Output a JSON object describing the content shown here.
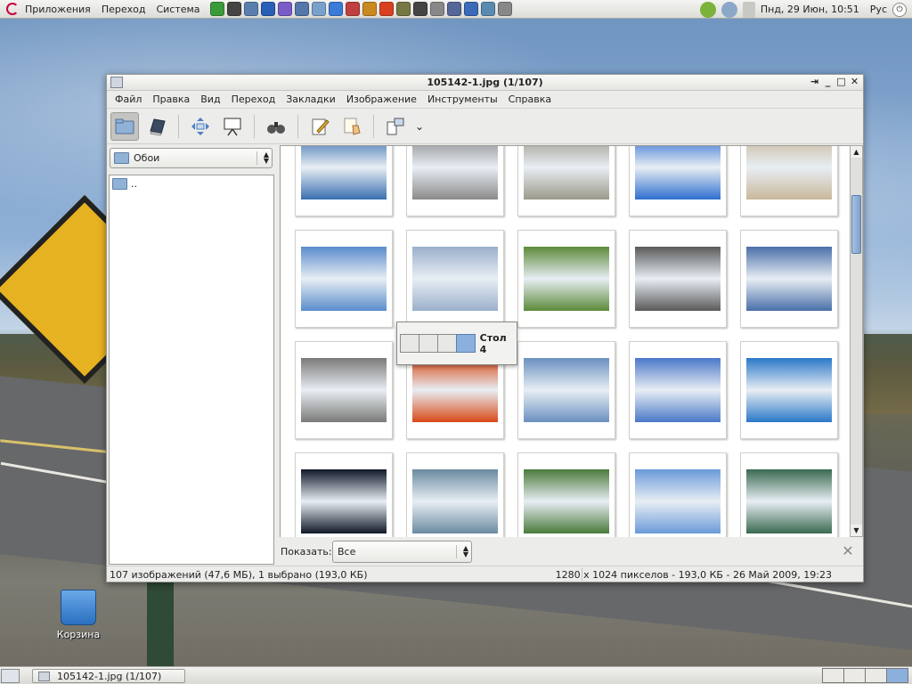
{
  "top_panel": {
    "menus": [
      "Приложения",
      "Переход",
      "Система"
    ],
    "launcher_colors": [
      "#3a9b3a",
      "#444444",
      "#5a7fae",
      "#2a5fb8",
      "#7a5cc8",
      "#5577aa",
      "#7aa0cc",
      "#3a7ad8",
      "#c04040",
      "#c88a20",
      "#d84020",
      "#777744",
      "#444444",
      "#888888",
      "#556699",
      "#3a6ab8",
      "#5a8ab0",
      "#888888"
    ],
    "clock": "Пнд, 29 Июн, 10:51",
    "keyboard_layout": "Рус"
  },
  "window": {
    "title": "105142-1.jpg  (1/107)",
    "menu": [
      "Файл",
      "Правка",
      "Вид",
      "Переход",
      "Закладки",
      "Изображение",
      "Инструменты",
      "Справка"
    ],
    "folder_combo": "Обои",
    "folder_items": [
      ".."
    ],
    "filter_label": "Показать:",
    "filter_value": "Все",
    "status_left": "107 изображений (47,6 МБ), 1 выбрано (193,0 КБ)",
    "status_right": "1280 x 1024 пикселов - 193,0 КБ - 26 Май 2009, 19:23",
    "thumbnails": [
      [
        "#3a6fb0",
        "#8a8a8a",
        "#9a9a8a",
        "#2f6fd0",
        "#c8b89a"
      ],
      [
        "#5a8ccc",
        "#9ab0cc",
        "#5c8a3a",
        "#5a5a5a",
        "#4a6fa8"
      ],
      [
        "#7a7a78",
        "#d84a18",
        "#6a90c0",
        "#4a78c8",
        "#2a78c8"
      ],
      [
        "#101828",
        "#6a8aa0",
        "#4a7a3a",
        "#6a9ad8",
        "#3a6a50"
      ]
    ]
  },
  "workspace_popup": {
    "label": "Стол 4",
    "cells": 4,
    "active": 4
  },
  "desktop": {
    "trash_label": "Корзина"
  },
  "bottom_panel": {
    "task_label": "105142-1.jpg  (1/107)",
    "workspaces": 4,
    "active_workspace": 4
  }
}
